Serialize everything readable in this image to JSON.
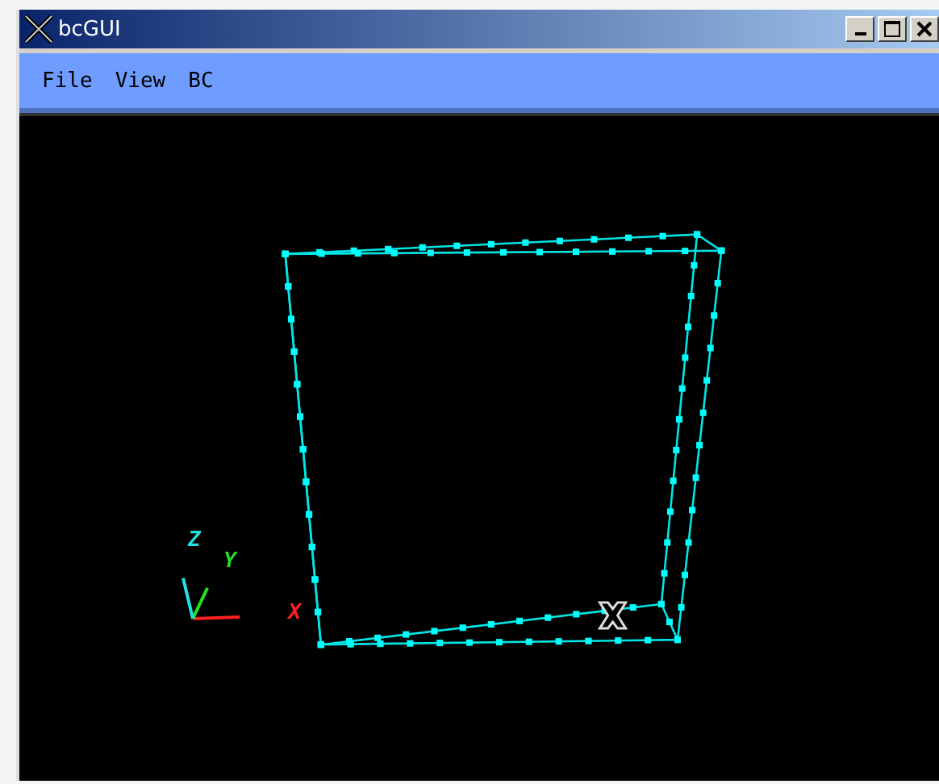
{
  "window": {
    "title": "bcGUI"
  },
  "menu": [
    "File",
    "View",
    "BC"
  ],
  "viewport": {
    "axes": [
      {
        "label": "X"
      },
      {
        "label": "Y"
      },
      {
        "label": "Z"
      }
    ]
  }
}
